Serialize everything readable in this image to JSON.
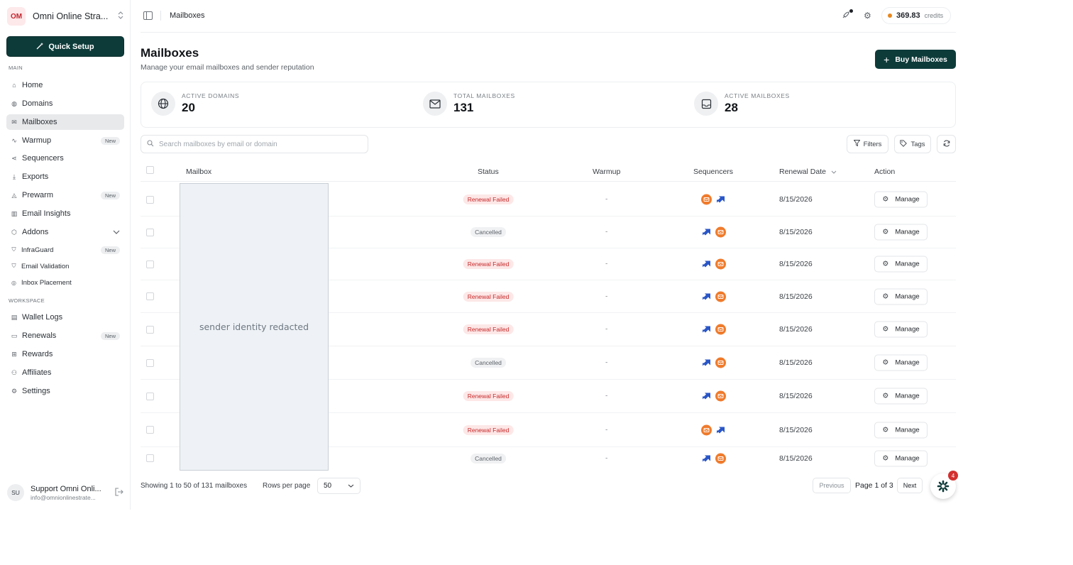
{
  "workspace": {
    "initials": "OM",
    "name": "Omni Online Stra..."
  },
  "sidebar": {
    "quick_setup": "Quick Setup",
    "section_main": "MAIN",
    "main_items": [
      {
        "label": "Home",
        "icon": "home-icon"
      },
      {
        "label": "Domains",
        "icon": "globe-icon"
      },
      {
        "label": "Mailboxes",
        "icon": "mail-icon",
        "active": true
      },
      {
        "label": "Warmup",
        "icon": "activity-icon",
        "badge": "New"
      },
      {
        "label": "Sequencers",
        "icon": "share-icon"
      },
      {
        "label": "Exports",
        "icon": "download-icon"
      },
      {
        "label": "Prewarm",
        "icon": "flame-icon",
        "badge": "New"
      },
      {
        "label": "Email Insights",
        "icon": "bar-chart-icon"
      },
      {
        "label": "Addons",
        "icon": "box-icon"
      }
    ],
    "addons": [
      {
        "label": "InfraGuard",
        "icon": "shield-icon",
        "badge": "New"
      },
      {
        "label": "Email Validation",
        "icon": "shield-check-icon"
      },
      {
        "label": "Inbox Placement",
        "icon": "target-icon"
      }
    ],
    "section_workspace": "WORKSPACE",
    "workspace_items": [
      {
        "label": "Wallet Logs",
        "icon": "receipt-icon"
      },
      {
        "label": "Renewals",
        "icon": "calendar-icon",
        "badge": "New"
      },
      {
        "label": "Rewards",
        "icon": "gift-icon"
      },
      {
        "label": "Affiliates",
        "icon": "users-icon"
      },
      {
        "label": "Settings",
        "icon": "gear-icon"
      }
    ],
    "user": {
      "initials": "SU",
      "name": "Support Omni Onli...",
      "email": "info@omnionlinestrate..."
    }
  },
  "topbar": {
    "breadcrumb": "Mailboxes",
    "credits_value": "369.83",
    "credits_unit": "credits"
  },
  "page": {
    "title": "Mailboxes",
    "subtitle": "Manage your email mailboxes and sender reputation",
    "buy_label": "Buy Mailboxes"
  },
  "stats": [
    {
      "label": "ACTIVE DOMAINS",
      "value": "20",
      "icon": "globe-icon"
    },
    {
      "label": "TOTAL MAILBOXES",
      "value": "131",
      "icon": "mail-icon"
    },
    {
      "label": "ACTIVE MAILBOXES",
      "value": "28",
      "icon": "inbox-icon"
    }
  ],
  "toolbar": {
    "search_placeholder": "Search mailboxes by email or domain",
    "filters": "Filters",
    "tags": "Tags"
  },
  "table": {
    "columns": {
      "mailbox": "Mailbox",
      "status": "Status",
      "warmup": "Warmup",
      "sequencers": "Sequencers",
      "renewal": "Renewal Date",
      "action": "Action"
    },
    "redacted_label": "sender identity redacted",
    "manage_label": "Manage",
    "rows": [
      {
        "status": "Renewal Failed",
        "warmup": "-",
        "seq": [
          "orange",
          "blue"
        ],
        "date": "8/15/2026"
      },
      {
        "status": "Cancelled",
        "warmup": "-",
        "seq": [
          "blue",
          "orange"
        ],
        "date": "8/15/2026"
      },
      {
        "status": "Renewal Failed",
        "warmup": "-",
        "seq": [
          "blue",
          "orange"
        ],
        "date": "8/15/2026"
      },
      {
        "status": "Renewal Failed",
        "warmup": "-",
        "seq": [
          "blue",
          "orange"
        ],
        "date": "8/15/2026"
      },
      {
        "status": "Renewal Failed",
        "warmup": "-",
        "seq": [
          "blue",
          "orange"
        ],
        "date": "8/15/2026"
      },
      {
        "status": "Cancelled",
        "warmup": "-",
        "seq": [
          "blue",
          "orange"
        ],
        "date": "8/15/2026"
      },
      {
        "status": "Renewal Failed",
        "warmup": "-",
        "seq": [
          "blue",
          "orange"
        ],
        "date": "8/15/2026"
      },
      {
        "status": "Renewal Failed",
        "warmup": "-",
        "seq": [
          "orange",
          "blue"
        ],
        "date": "8/15/2026"
      },
      {
        "status": "Cancelled",
        "warmup": "-",
        "seq": [
          "blue",
          "orange"
        ],
        "date": "8/15/2026"
      }
    ]
  },
  "footer": {
    "showing": "Showing 1 to 50 of 131 mailboxes",
    "rows_per_page_label": "Rows per page",
    "rows_per_page_value": "50",
    "previous": "Previous",
    "page_info": "Page 1 of 3",
    "next": "Next",
    "notification_count": "4"
  },
  "colors": {
    "brand": "#0d3b3a",
    "status_failed": "#c62828",
    "sequencer_orange": "#ef7b2c",
    "sequencer_blue": "#2a56c6"
  }
}
